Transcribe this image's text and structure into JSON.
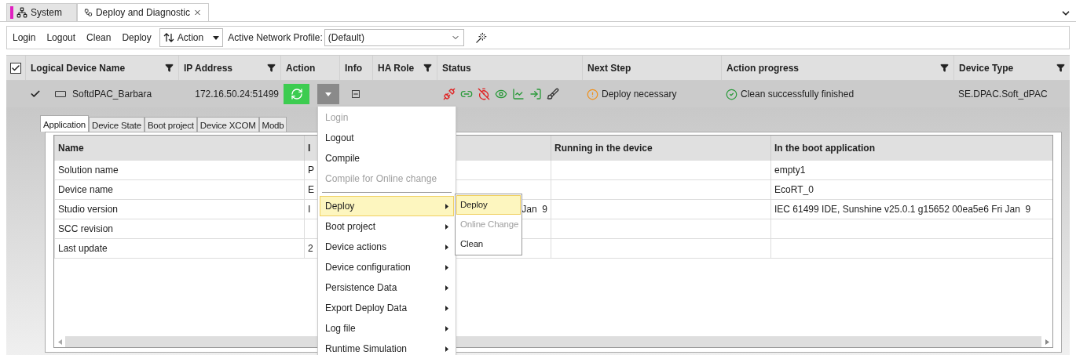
{
  "doc_tabs": [
    {
      "label": "System",
      "selected": false,
      "closable": false
    },
    {
      "label": "Deploy and Diagnostic",
      "selected": true,
      "closable": true
    }
  ],
  "toolbar": {
    "buttons": [
      "Login",
      "Logout",
      "Clean",
      "Deploy"
    ],
    "action_menu": "Action",
    "profile_label": "Active Network Profile:",
    "profile_value": "(Default)"
  },
  "grid": {
    "all_checked": true,
    "columns": [
      {
        "label": "Logical Device Name",
        "filter": true
      },
      {
        "label": "IP Address",
        "filter": true
      },
      {
        "label": "Action",
        "filter": false
      },
      {
        "label": "Info",
        "filter": false
      },
      {
        "label": "HA Role",
        "filter": true
      },
      {
        "label": "Status",
        "filter": false
      },
      {
        "label": "Next Step",
        "filter": false
      },
      {
        "label": "Action progress",
        "filter": true
      },
      {
        "label": "Device Type",
        "filter": true
      }
    ],
    "rows": [
      {
        "checked": true,
        "selected": true,
        "name": "SoftdPAC_Barbara",
        "ip": "172.16.50.24:51499",
        "next_step": "Deploy necessary",
        "progress": "Clean successfully finished",
        "device_type": "SE.DPAC.Soft_dPAC"
      }
    ]
  },
  "detail": {
    "tabs": [
      {
        "label": "Application",
        "selected": true
      },
      {
        "label": "Device State",
        "selected": false
      },
      {
        "label": "Boot project",
        "selected": false
      },
      {
        "label": "Device XCOM",
        "selected": false
      },
      {
        "label": "Modb",
        "selected": false
      }
    ],
    "columns": [
      "Name",
      "I",
      "Running in the device",
      "In the boot application"
    ],
    "rows": [
      {
        "name": "Solution name",
        "col_2": "P",
        "col_2_tail": "",
        "running": "",
        "boot": "empty1"
      },
      {
        "name": "Device name",
        "col_2": "E",
        "col_2_tail": "",
        "running": "",
        "boot": "EcoRT_0"
      },
      {
        "name": "Studio version",
        "col_2": "I",
        "col_2_tail": "Jan  9",
        "running": "",
        "boot": "IEC 61499 IDE, Sunshine v25.0.1 g15652 00ea5e6 Fri Jan  9"
      },
      {
        "name": "SCC revision",
        "col_2": "",
        "col_2_tail": "",
        "running": "",
        "boot": ""
      },
      {
        "name": "Last update",
        "col_2": "2",
        "col_2_tail": "",
        "running": "",
        "boot": ""
      }
    ]
  },
  "context_menu": {
    "items": [
      {
        "kind": "item",
        "label": "Login",
        "disabled": true,
        "submenu": false,
        "selected": false
      },
      {
        "kind": "item",
        "label": "Logout",
        "disabled": false,
        "submenu": false,
        "selected": false
      },
      {
        "kind": "item",
        "label": "Compile",
        "disabled": false,
        "submenu": false,
        "selected": false
      },
      {
        "kind": "item",
        "label": "Compile for Online change",
        "disabled": true,
        "submenu": false,
        "selected": false
      },
      {
        "kind": "separator"
      },
      {
        "kind": "item",
        "label": "Deploy",
        "disabled": false,
        "submenu": true,
        "selected": true
      },
      {
        "kind": "item",
        "label": "Boot project",
        "disabled": false,
        "submenu": true,
        "selected": false
      },
      {
        "kind": "item",
        "label": "Device actions",
        "disabled": false,
        "submenu": true,
        "selected": false
      },
      {
        "kind": "item",
        "label": "Device configuration",
        "disabled": false,
        "submenu": true,
        "selected": false
      },
      {
        "kind": "item",
        "label": "Persistence Data",
        "disabled": false,
        "submenu": true,
        "selected": false
      },
      {
        "kind": "item",
        "label": "Export Deploy Data",
        "disabled": false,
        "submenu": true,
        "selected": false
      },
      {
        "kind": "item",
        "label": "Log file",
        "disabled": false,
        "submenu": true,
        "selected": false
      },
      {
        "kind": "item",
        "label": "Runtime Simulation",
        "disabled": false,
        "submenu": true,
        "selected": false
      }
    ]
  },
  "submenu": {
    "items": [
      {
        "label": "Deploy",
        "disabled": false,
        "selected": true
      },
      {
        "label": "Online Change",
        "disabled": true,
        "selected": false
      },
      {
        "label": "Clean",
        "disabled": false,
        "selected": false
      }
    ]
  }
}
